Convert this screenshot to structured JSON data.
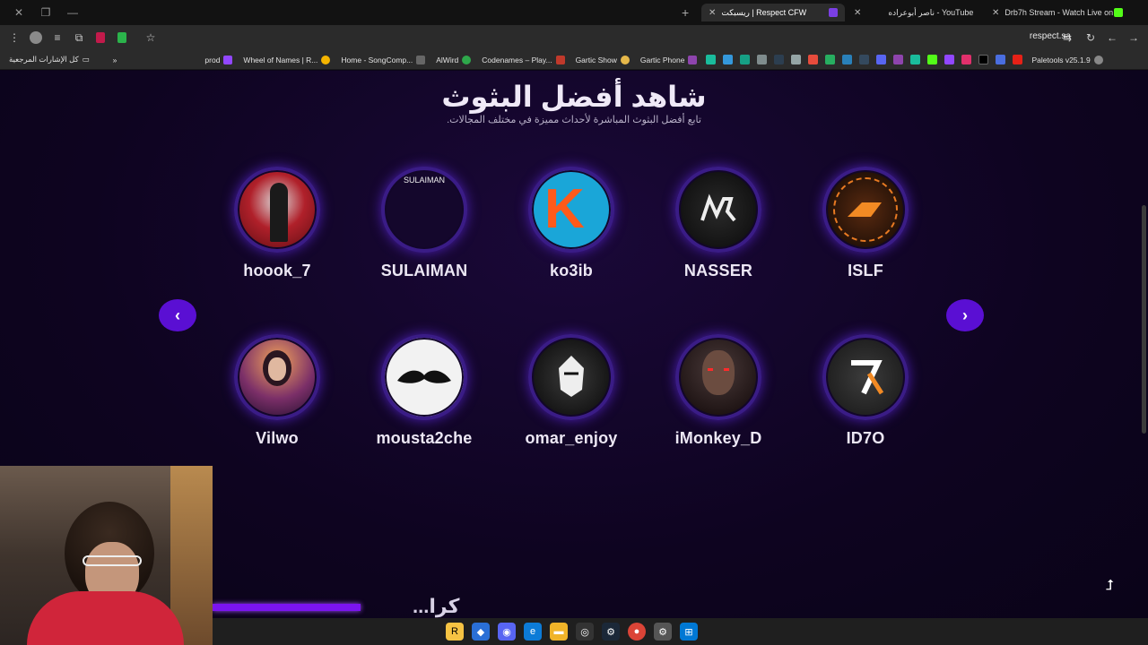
{
  "browser": {
    "tabs": [
      {
        "title": "ريسبكت | Respect CFW",
        "active": true
      },
      {
        "title": "ناصر أبوعراده - YouTube",
        "active": false
      },
      {
        "title": "Drb7h Stream - Watch Live on",
        "active": false
      }
    ],
    "url": "respect.sa",
    "bookmarks_folder": "كل الإشارات المرجعية",
    "bookmarks": [
      "prod",
      "Wheel of Names | R...",
      "Home - SongComp...",
      "AlWird",
      "Codenames – Play...",
      "Gartic Show",
      "Gartic Phone",
      "Paletools v25.1.9"
    ]
  },
  "page": {
    "title": "شاهد أفضل البثوث",
    "subtitle": "تابع أفضل البثوث المباشرة لأحداث مميزة في مختلف المجالات.",
    "streamers": [
      {
        "name": "hoook_7"
      },
      {
        "name": "SULAIMAN",
        "avatar_text": "SULAIMAN"
      },
      {
        "name": "ko3ib",
        "avatar_text": "K"
      },
      {
        "name": "NASSER"
      },
      {
        "name": "ISLF"
      },
      {
        "name": "Vilwo"
      },
      {
        "name": "mousta2che"
      },
      {
        "name": "omar_enjoy"
      },
      {
        "name": "iMonkey_D"
      },
      {
        "name": "ID7O"
      }
    ],
    "prev_label": "‹",
    "next_label": "›",
    "scroll_top_label": "⮥",
    "partial_heading": "كرا..."
  }
}
